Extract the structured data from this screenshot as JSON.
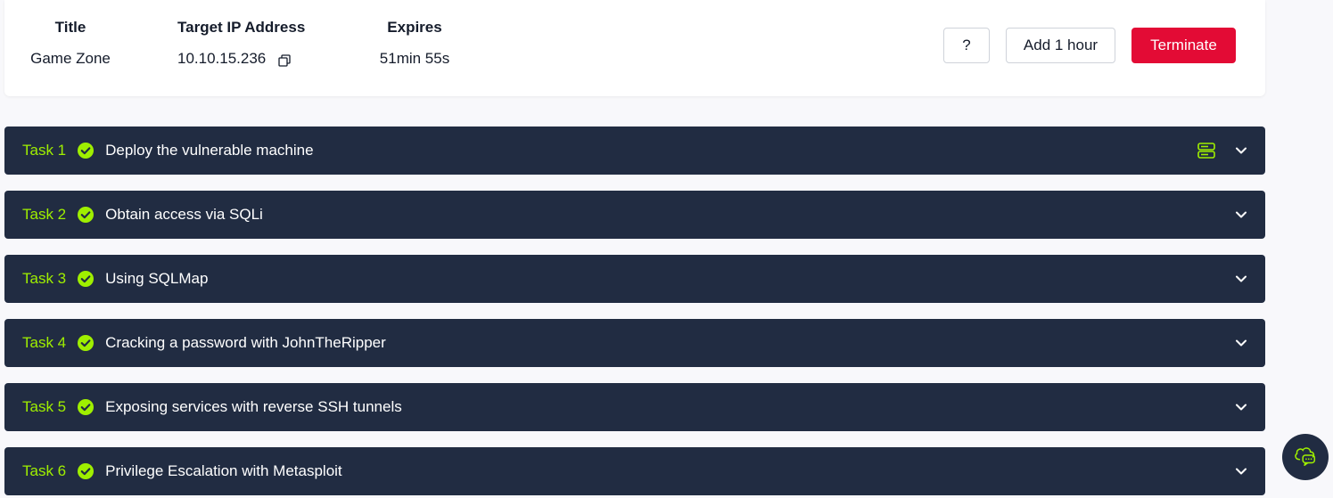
{
  "machine": {
    "title_label": "Title",
    "title_value": "Game Zone",
    "ip_label": "Target IP Address",
    "ip_value": "10.10.15.236",
    "expires_label": "Expires",
    "expires_value": "51min 55s"
  },
  "buttons": {
    "help": "?",
    "add_hour": "Add 1 hour",
    "terminate": "Terminate"
  },
  "colors": {
    "accent": "#9fef00",
    "task_bg": "#212c42",
    "terminate": "#e30b35"
  },
  "tasks": [
    {
      "number": "Task 1",
      "title": "Deploy the vulnerable machine",
      "completed": true,
      "icon": "server-icon"
    },
    {
      "number": "Task 2",
      "title": "Obtain access via SQLi",
      "completed": true
    },
    {
      "number": "Task 3",
      "title": "Using SQLMap",
      "completed": true
    },
    {
      "number": "Task 4",
      "title": "Cracking a password with JohnTheRipper",
      "completed": true
    },
    {
      "number": "Task 5",
      "title": "Exposing services with reverse SSH tunnels",
      "completed": true
    },
    {
      "number": "Task 6",
      "title": "Privilege Escalation with Metasploit",
      "completed": true
    }
  ]
}
